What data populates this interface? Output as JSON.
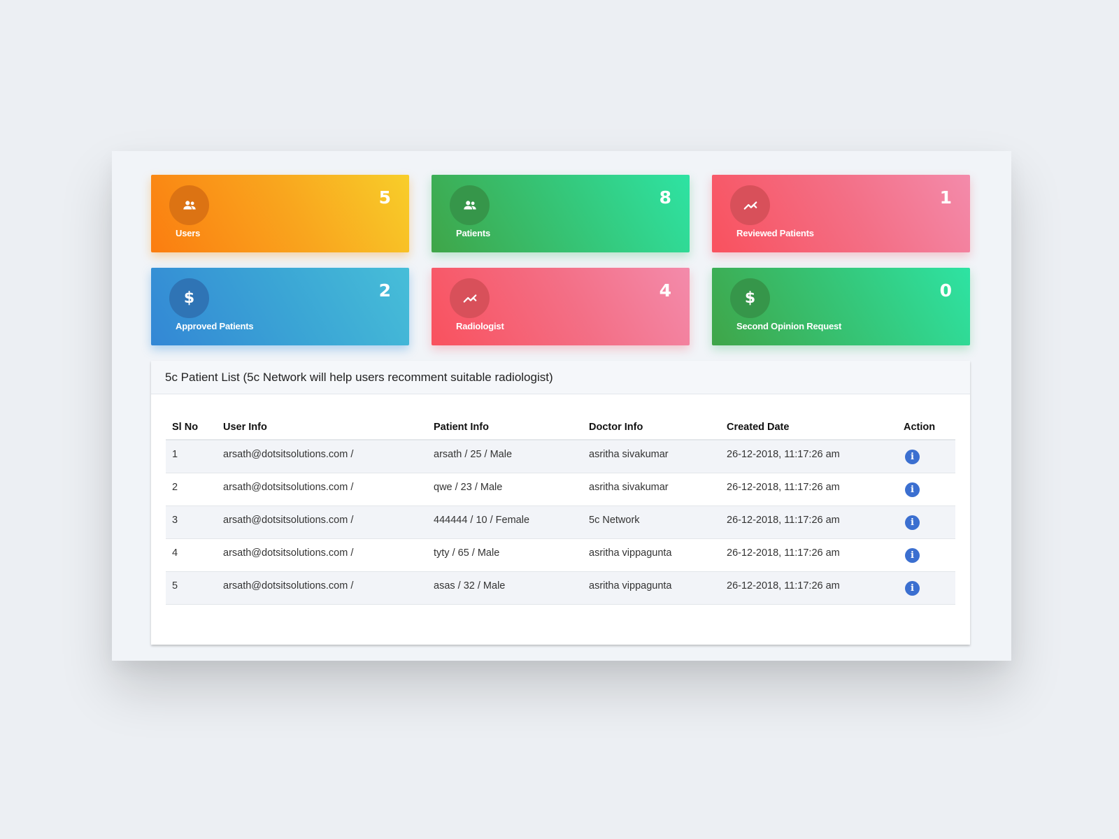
{
  "cards": [
    {
      "label": "Users",
      "count": "5",
      "icon": "users-icon",
      "color": "orange"
    },
    {
      "label": "Patients",
      "count": "8",
      "icon": "users-icon",
      "color": "green"
    },
    {
      "label": "Reviewed Patients",
      "count": "1",
      "icon": "trend-icon",
      "color": "red"
    },
    {
      "label": "Approved Patients",
      "count": "2",
      "icon": "dollar-icon",
      "color": "blue"
    },
    {
      "label": "Radiologist",
      "count": "4",
      "icon": "trend-icon",
      "color": "red"
    },
    {
      "label": "Second Opinion Request",
      "count": "0",
      "icon": "dollar-icon",
      "color": "green"
    }
  ],
  "panel": {
    "title": "5c Patient List (5c Network will help users recomment suitable radiologist)"
  },
  "table": {
    "columns": [
      "Sl No",
      "User Info",
      "Patient Info",
      "Doctor Info",
      "Created Date",
      "Action"
    ],
    "rows": [
      {
        "sl": "1",
        "user": "arsath@dotsitsolutions.com /",
        "patient": "arsath / 25 / Male",
        "doctor": "asritha sivakumar",
        "date": "26-12-2018, 11:17:26 am"
      },
      {
        "sl": "2",
        "user": "arsath@dotsitsolutions.com /",
        "patient": "qwe / 23 / Male",
        "doctor": "asritha sivakumar",
        "date": "26-12-2018, 11:17:26 am"
      },
      {
        "sl": "3",
        "user": "arsath@dotsitsolutions.com /",
        "patient": "444444 / 10 / Female",
        "doctor": "5c Network",
        "date": "26-12-2018, 11:17:26 am"
      },
      {
        "sl": "4",
        "user": "arsath@dotsitsolutions.com /",
        "patient": "tyty / 65 / Male",
        "doctor": "asritha vippagunta",
        "date": "26-12-2018, 11:17:26 am"
      },
      {
        "sl": "5",
        "user": "arsath@dotsitsolutions.com /",
        "patient": "asas / 32 / Male",
        "doctor": "asritha vippagunta",
        "date": "26-12-2018, 11:17:26 am"
      }
    ],
    "action_icon": "info-icon",
    "action_glyph": "i"
  }
}
